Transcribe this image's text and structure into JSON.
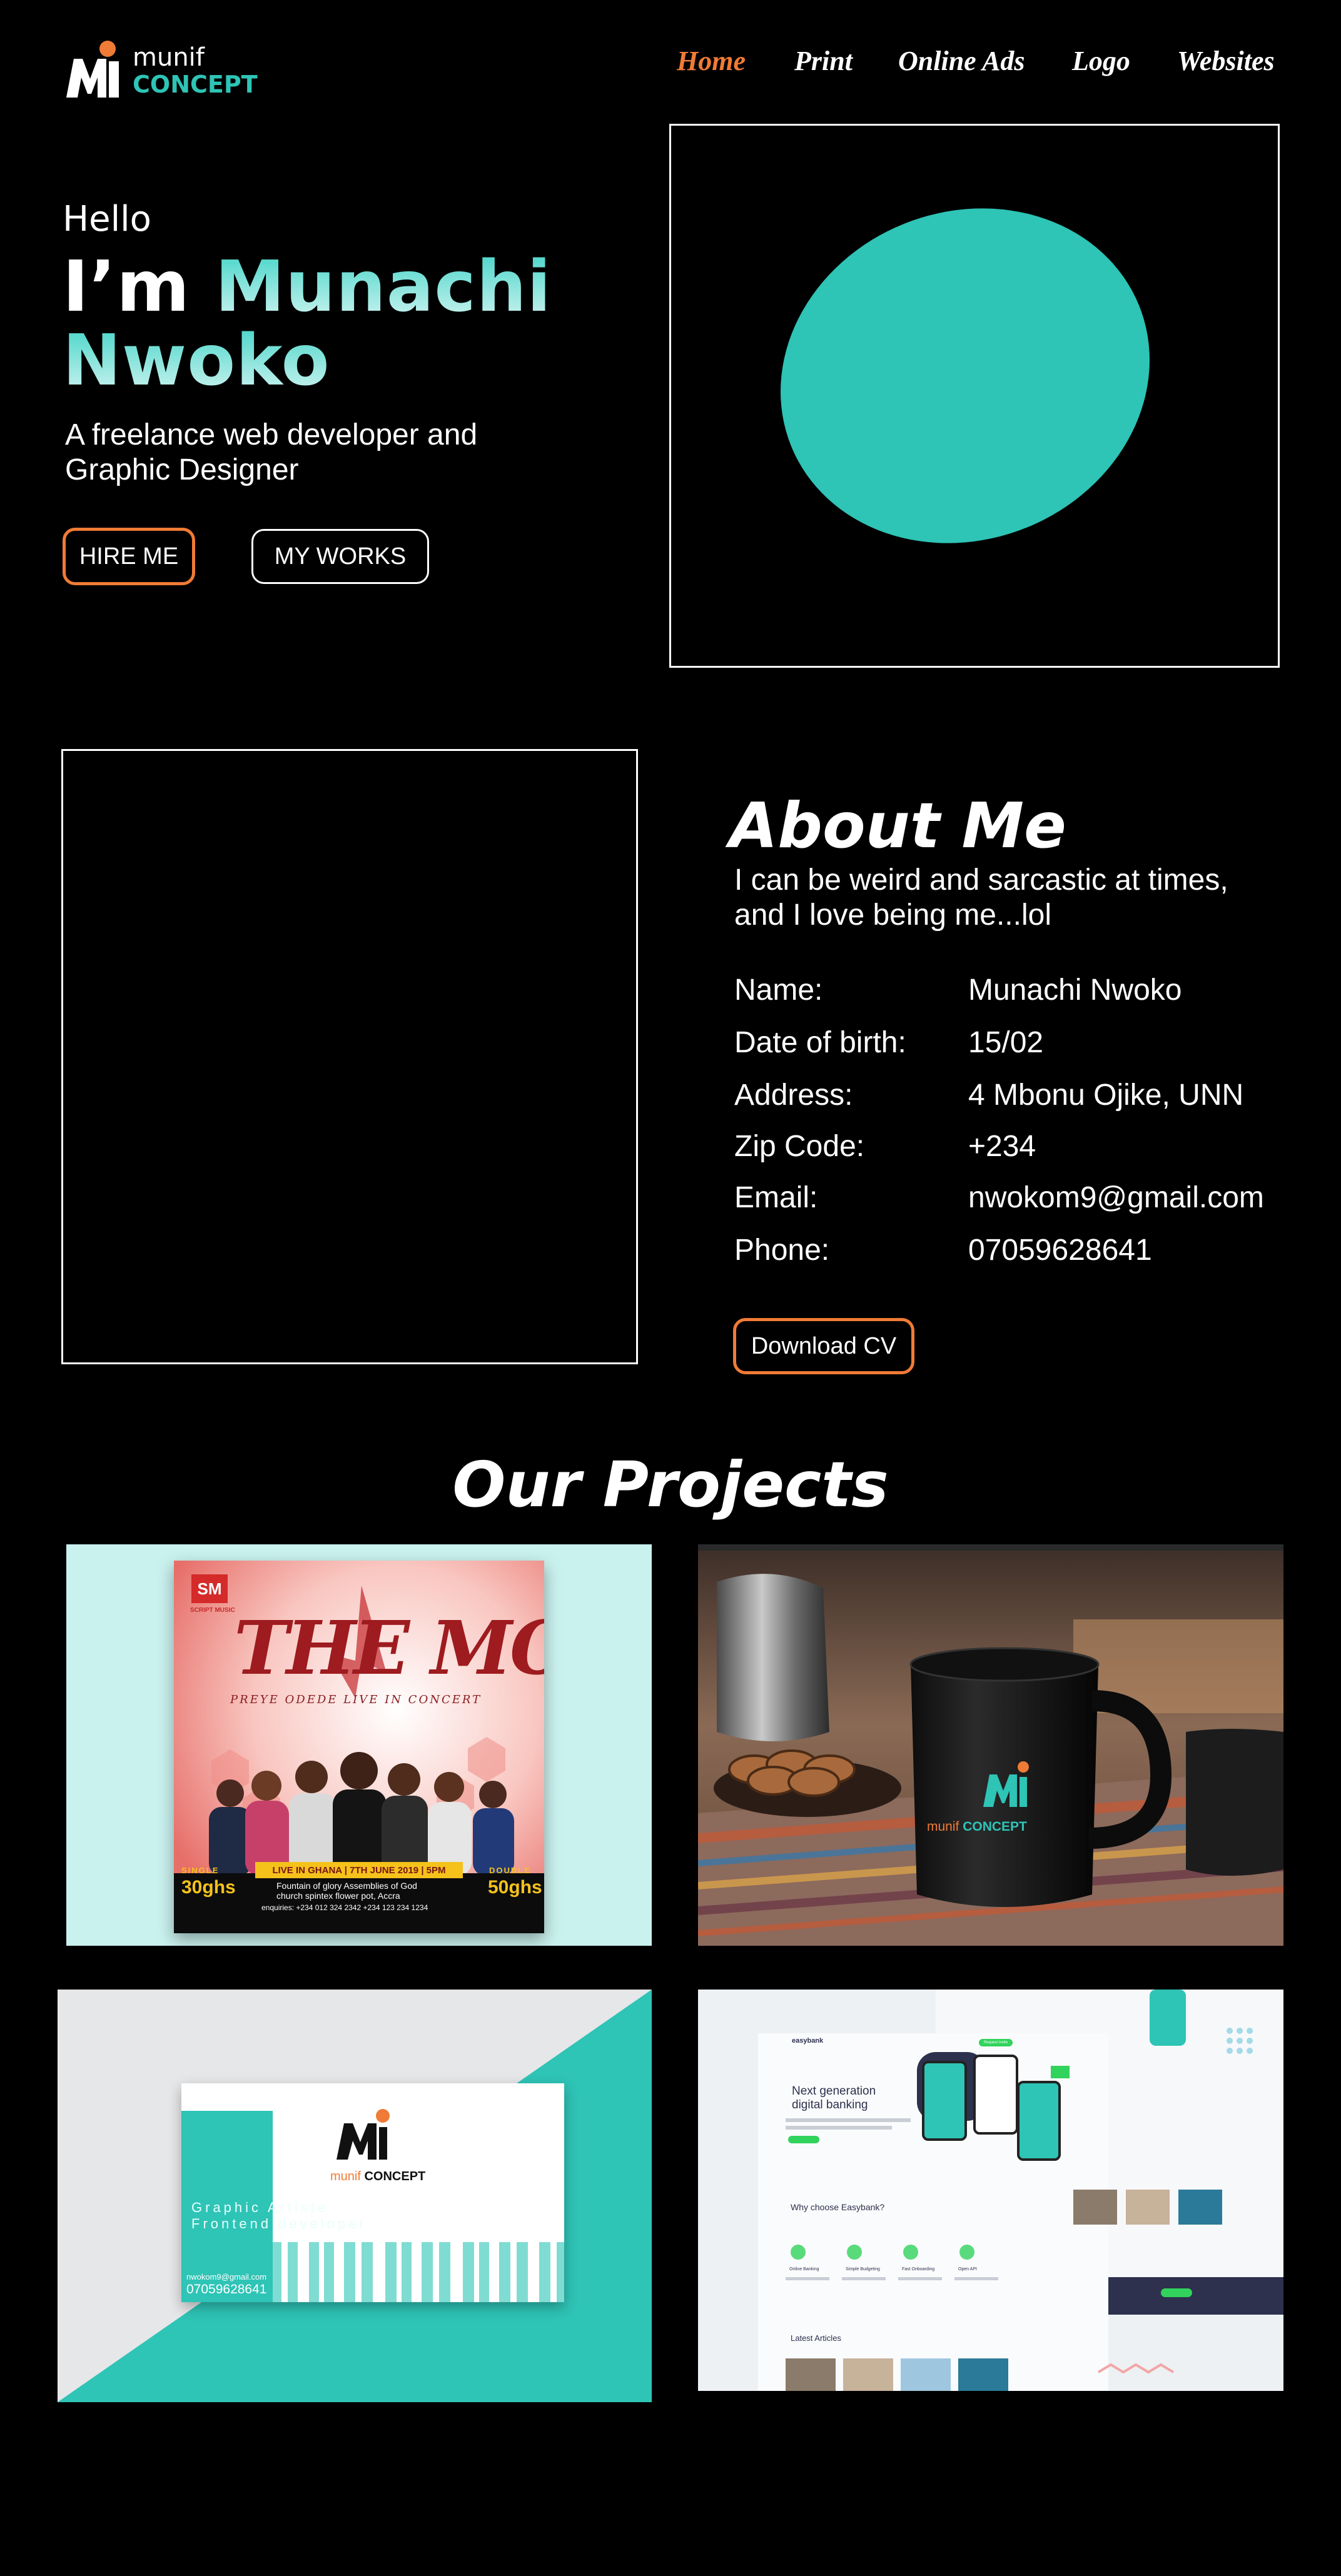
{
  "brand": {
    "name_line1": "munif",
    "name_line2": "CONCEPT",
    "accent_color": "#2ec4b6",
    "orange_color": "#f07b36"
  },
  "nav": {
    "items": [
      {
        "label": "Home",
        "active": true
      },
      {
        "label": "Print",
        "active": false
      },
      {
        "label": "Online Ads",
        "active": false
      },
      {
        "label": "Logo",
        "active": false
      },
      {
        "label": "Websites",
        "active": false
      }
    ]
  },
  "hero": {
    "greeting": "Hello",
    "prefix": "I’m",
    "first_name": "Munachi",
    "last_name": "Nwoko",
    "tagline": "A freelance web developer and Graphic Designer",
    "hire_button": "HIRE ME",
    "works_button": "MY WORKS"
  },
  "about": {
    "title": "About Me",
    "text": "I can be weird and sarcastic at times, and I love being me...lol",
    "fields": [
      {
        "label": "Name:",
        "value": "Munachi Nwoko"
      },
      {
        "label": "Date of birth:",
        "value": "15/02"
      },
      {
        "label": "Address:",
        "value": "4 Mbonu Ojike, UNN"
      },
      {
        "label": "Zip Code:",
        "value": "+234"
      },
      {
        "label": "Email:",
        "value": "nwokom9@gmail.com"
      },
      {
        "label": "Phone:",
        "value": "07059628641"
      }
    ],
    "cv_button": "Download CV"
  },
  "projects": {
    "title": "Our Projects",
    "poster": {
      "badge": "SM",
      "badge_sub": "SCRIPT MUSIC",
      "headline": "THE MOVE",
      "subhead": "PREYE ODEDE LIVE IN CONCERT",
      "banner": "LIVE IN GHANA | 7TH JUNE 2019 | 5PM",
      "single_label": "SINGLE",
      "single_price": "30ghs",
      "double_label": "DOUBLE",
      "double_price": "50ghs",
      "venue": "Fountain of glory Assemblies of God church spintex flower pot, Accra",
      "enquiries": "enquiries: +234 012 324 2342  +234 123 234 1234"
    },
    "mug": {
      "brand_line1": "munif",
      "brand_line2": "CONCEPT"
    },
    "card": {
      "brand_line1": "munif",
      "brand_line2": "CONCEPT",
      "role1": "Graphic Artiste",
      "role2": "Frontend developer",
      "email": "nwokom9@gmail.com",
      "phone": "07059628641"
    },
    "website": {
      "logo": "easybank",
      "headline": "Next generation digital banking",
      "why": "Why choose Easybank?",
      "latest": "Latest Articles",
      "feature1": "Online Banking",
      "feature2": "Simple Budgeting",
      "feature3": "Fast Onboarding",
      "feature4": "Open API",
      "cta": "Request Invite"
    }
  }
}
